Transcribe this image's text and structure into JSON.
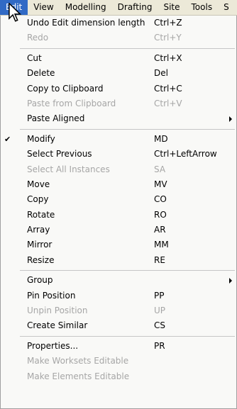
{
  "menubar": {
    "items": [
      "Edit",
      "View",
      "Modelling",
      "Drafting",
      "Site",
      "Tools",
      "S"
    ],
    "active_index": 0
  },
  "menu": {
    "rows": [
      {
        "label": "Undo Edit dimension length",
        "shortcut": "Ctrl+Z",
        "disabled": false
      },
      {
        "label": "Redo",
        "shortcut": "Ctrl+Y",
        "disabled": true
      },
      {
        "sep": true
      },
      {
        "label": "Cut",
        "shortcut": "Ctrl+X",
        "disabled": false
      },
      {
        "label": "Delete",
        "shortcut": "Del",
        "disabled": false
      },
      {
        "label": "Copy to Clipboard",
        "shortcut": "Ctrl+C",
        "disabled": false
      },
      {
        "label": "Paste from Clipboard",
        "shortcut": "Ctrl+V",
        "disabled": true
      },
      {
        "label": "Paste Aligned",
        "shortcut": "",
        "disabled": false,
        "submenu": true
      },
      {
        "sep": true
      },
      {
        "label": "Modify",
        "shortcut": "MD",
        "disabled": false,
        "checked": true
      },
      {
        "label": "Select Previous",
        "shortcut": "Ctrl+LeftArrow",
        "disabled": false
      },
      {
        "label": "Select All Instances",
        "shortcut": "SA",
        "disabled": true
      },
      {
        "label": "Move",
        "shortcut": "MV",
        "disabled": false
      },
      {
        "label": "Copy",
        "shortcut": "CO",
        "disabled": false
      },
      {
        "label": "Rotate",
        "shortcut": "RO",
        "disabled": false
      },
      {
        "label": "Array",
        "shortcut": "AR",
        "disabled": false
      },
      {
        "label": "Mirror",
        "shortcut": "MM",
        "disabled": false
      },
      {
        "label": "Resize",
        "shortcut": "RE",
        "disabled": false
      },
      {
        "sep": true
      },
      {
        "label": "Group",
        "shortcut": "",
        "disabled": false,
        "submenu": true
      },
      {
        "label": "Pin Position",
        "shortcut": "PP",
        "disabled": false
      },
      {
        "label": "Unpin Position",
        "shortcut": "UP",
        "disabled": true
      },
      {
        "label": "Create Similar",
        "shortcut": "CS",
        "disabled": false
      },
      {
        "sep": true
      },
      {
        "label": "Properties...",
        "shortcut": "PR",
        "disabled": false
      },
      {
        "label": "Make Worksets Editable",
        "shortcut": "",
        "disabled": true
      },
      {
        "label": "Make Elements Editable",
        "shortcut": "",
        "disabled": true
      }
    ]
  },
  "icons": {
    "check": "checkmark-icon",
    "submenu": "submenu-arrow-icon",
    "cursor": "mouse-pointer-icon"
  },
  "colors": {
    "menubar_bg": "#ece9d8",
    "highlight": "#316ac5",
    "menu_bg": "#f9f9f7",
    "disabled_text": "#a6a6a6"
  }
}
